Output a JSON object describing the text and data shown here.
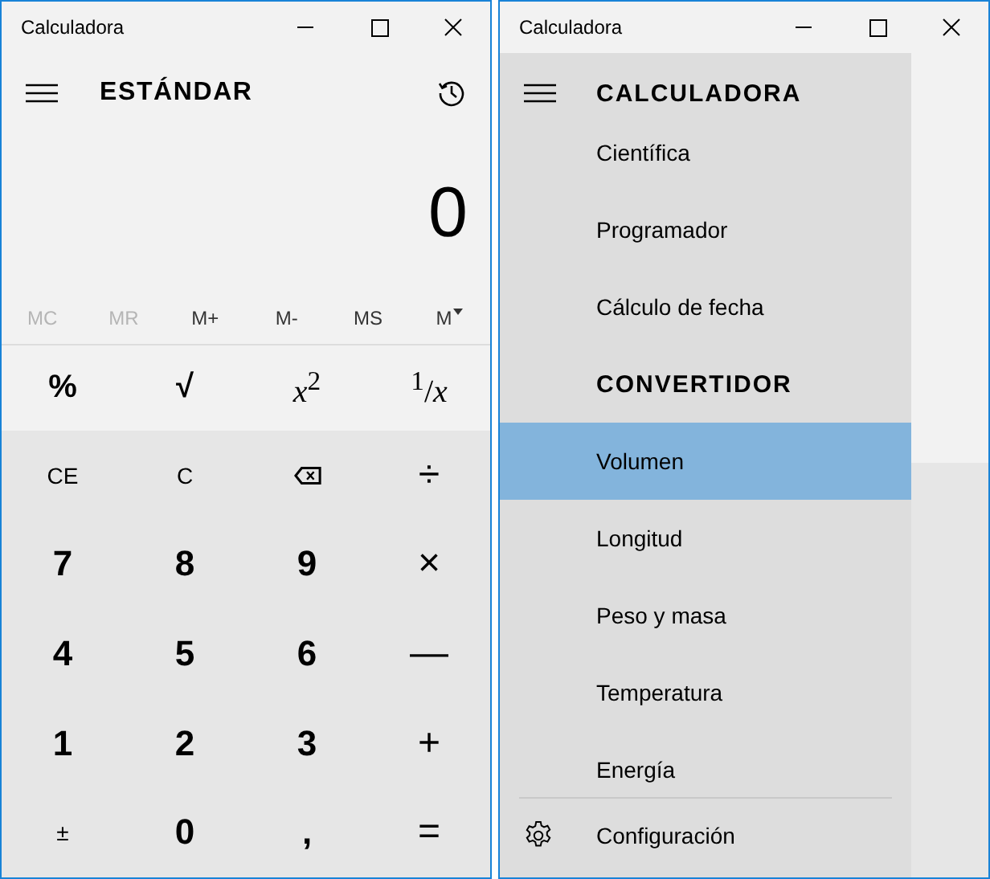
{
  "calculator": {
    "title": "Calculadora",
    "mode": "ESTÁNDAR",
    "display": "0",
    "memory": [
      {
        "label": "MC",
        "disabled": true,
        "kind": "plain"
      },
      {
        "label": "MR",
        "disabled": true,
        "kind": "plain"
      },
      {
        "label": "M+",
        "disabled": false,
        "kind": "plain"
      },
      {
        "label": "M-",
        "disabled": false,
        "kind": "plain"
      },
      {
        "label": "MS",
        "disabled": false,
        "kind": "plain"
      },
      {
        "label": "M",
        "disabled": false,
        "kind": "dropdown"
      }
    ],
    "function_keys": [
      {
        "label": "%",
        "kind": "text"
      },
      {
        "label": "√",
        "kind": "text"
      },
      {
        "label": "*x*$^{2}$",
        "kind": "math"
      },
      {
        "label": "$^{1}$/*x*",
        "kind": "math"
      }
    ],
    "keypad": [
      {
        "label": "CE",
        "kind": "small"
      },
      {
        "label": "C",
        "kind": "small"
      },
      {
        "kind": "backspace"
      },
      {
        "label": "÷",
        "kind": "op"
      },
      {
        "label": "7",
        "kind": "digit"
      },
      {
        "label": "8",
        "kind": "digit"
      },
      {
        "label": "9",
        "kind": "digit"
      },
      {
        "label": "×",
        "kind": "op"
      },
      {
        "label": "4",
        "kind": "digit"
      },
      {
        "label": "5",
        "kind": "digit"
      },
      {
        "label": "6",
        "kind": "digit"
      },
      {
        "label": "—",
        "kind": "op"
      },
      {
        "label": "1",
        "kind": "digit"
      },
      {
        "label": "2",
        "kind": "digit"
      },
      {
        "label": "3",
        "kind": "digit"
      },
      {
        "label": "+",
        "kind": "op"
      },
      {
        "label": "±",
        "kind": "small"
      },
      {
        "label": "0",
        "kind": "digit"
      },
      {
        "label": ",",
        "kind": "digit"
      },
      {
        "label": "=",
        "kind": "op"
      }
    ]
  },
  "navigation": {
    "title": "Calculadora",
    "sections": [
      {
        "heading": "CALCULADORA",
        "items": [
          {
            "label": "Científica",
            "selected": false
          },
          {
            "label": "Programador",
            "selected": false
          },
          {
            "label": "Cálculo de fecha",
            "selected": false
          }
        ]
      },
      {
        "heading": "CONVERTIDOR",
        "items": [
          {
            "label": "Volumen",
            "selected": true
          },
          {
            "label": "Longitud",
            "selected": false
          },
          {
            "label": "Peso y masa",
            "selected": false
          },
          {
            "label": "Temperatura",
            "selected": false
          },
          {
            "label": "Energía",
            "selected": false
          }
        ]
      }
    ],
    "settings": "Configuración"
  }
}
